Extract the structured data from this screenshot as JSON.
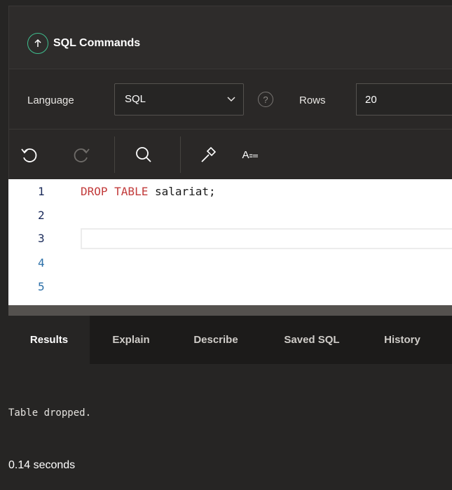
{
  "header": {
    "title": "SQL Commands",
    "icon": "arrow-up-circle-icon",
    "accent_color": "#3fbf8f"
  },
  "langbar": {
    "language_label": "Language",
    "language_value": "SQL",
    "help_symbol": "?",
    "rows_label": "Rows",
    "rows_value": "20"
  },
  "editor_toolbar": {
    "az_label": "A⩴"
  },
  "editor": {
    "line_numbers": [
      "1",
      "2",
      "3",
      "4",
      "5"
    ],
    "lines": [
      {
        "keyword": "DROP TABLE",
        "rest": " salariat;"
      },
      {
        "keyword": "",
        "rest": ""
      },
      {
        "keyword": "",
        "rest": ""
      },
      {
        "keyword": "",
        "rest": ""
      },
      {
        "keyword": "",
        "rest": ""
      }
    ],
    "keyword_color": "#c23b3b"
  },
  "tabs": [
    {
      "label": "Results",
      "active": true
    },
    {
      "label": "Explain",
      "active": false
    },
    {
      "label": "Describe",
      "active": false
    },
    {
      "label": "Saved SQL",
      "active": false
    },
    {
      "label": "History",
      "active": false
    }
  ],
  "results": {
    "message": "Table dropped.",
    "elapsed": "0.14 seconds"
  }
}
